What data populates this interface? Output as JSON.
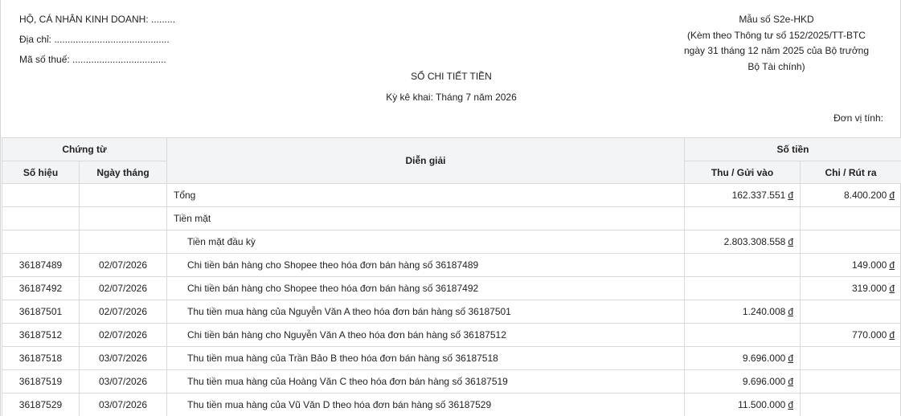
{
  "header": {
    "business_line": "HỘ, CÁ NHÂN KINH DOANH: .........",
    "address_line": "Địa chỉ: ...........................................",
    "tax_line": "Mã số thuế: ...................................",
    "form_no": "Mẫu số S2e-HKD",
    "form_ref_1": "(Kèm theo Thông tư số 152/2025/TT-BTC",
    "form_ref_2": "ngày 31 tháng 12 năm 2025 của Bộ trưởng",
    "form_ref_3": "Bộ Tài chính)"
  },
  "title": "SỔ CHI TIẾT TIỀN",
  "period": "Kỳ kê khai: Tháng 7 năm 2026",
  "unit_label": "Đơn vị tính:",
  "columns": {
    "voucher": "Chứng từ",
    "voucher_no": "Số hiệu",
    "voucher_date": "Ngày tháng",
    "description": "Diễn giải",
    "amount": "Số tiền",
    "income": "Thu / Gửi vào",
    "expense": "Chi / Rút ra"
  },
  "currency_symbol": "đ",
  "rows": [
    {
      "no": "",
      "date": "",
      "desc": "Tổng",
      "indent": false,
      "income": "162.337.551",
      "expense": "8.400.200"
    },
    {
      "no": "",
      "date": "",
      "desc": "Tiền mặt",
      "indent": false,
      "income": "",
      "expense": ""
    },
    {
      "no": "",
      "date": "",
      "desc": "Tiền mặt đầu kỳ",
      "indent": true,
      "income": "2.803.308.558",
      "expense": ""
    },
    {
      "no": "36187489",
      "date": "02/07/2026",
      "desc": "Chi tiền bán hàng cho Shopee theo hóa đơn bán hàng số 36187489",
      "indent": true,
      "income": "",
      "expense": "149.000"
    },
    {
      "no": "36187492",
      "date": "02/07/2026",
      "desc": "Chi tiền bán hàng cho Shopee theo hóa đơn bán hàng số 36187492",
      "indent": true,
      "income": "",
      "expense": "319.000"
    },
    {
      "no": "36187501",
      "date": "02/07/2026",
      "desc": "Thu tiền mua hàng của Nguyễn Văn A theo hóa đơn bán hàng số 36187501",
      "indent": true,
      "income": "1.240.008",
      "expense": ""
    },
    {
      "no": "36187512",
      "date": "02/07/2026",
      "desc": "Chi tiền bán hàng cho Nguyễn Văn A theo hóa đơn bán hàng số 36187512",
      "indent": true,
      "income": "",
      "expense": "770.000"
    },
    {
      "no": "36187518",
      "date": "03/07/2026",
      "desc": "Thu tiền mua hàng của Trần Bảo B theo hóa đơn bán hàng số 36187518",
      "indent": true,
      "income": "9.696.000",
      "expense": ""
    },
    {
      "no": "36187519",
      "date": "03/07/2026",
      "desc": "Thu tiền mua hàng của Hoàng Văn C theo hóa đơn bán hàng số 36187519",
      "indent": true,
      "income": "9.696.000",
      "expense": ""
    },
    {
      "no": "36187529",
      "date": "03/07/2026",
      "desc": "Thu tiền mua hàng của Vũ Văn D theo hóa đơn bán hàng số 36187529",
      "indent": true,
      "income": "11.500.000",
      "expense": ""
    }
  ]
}
